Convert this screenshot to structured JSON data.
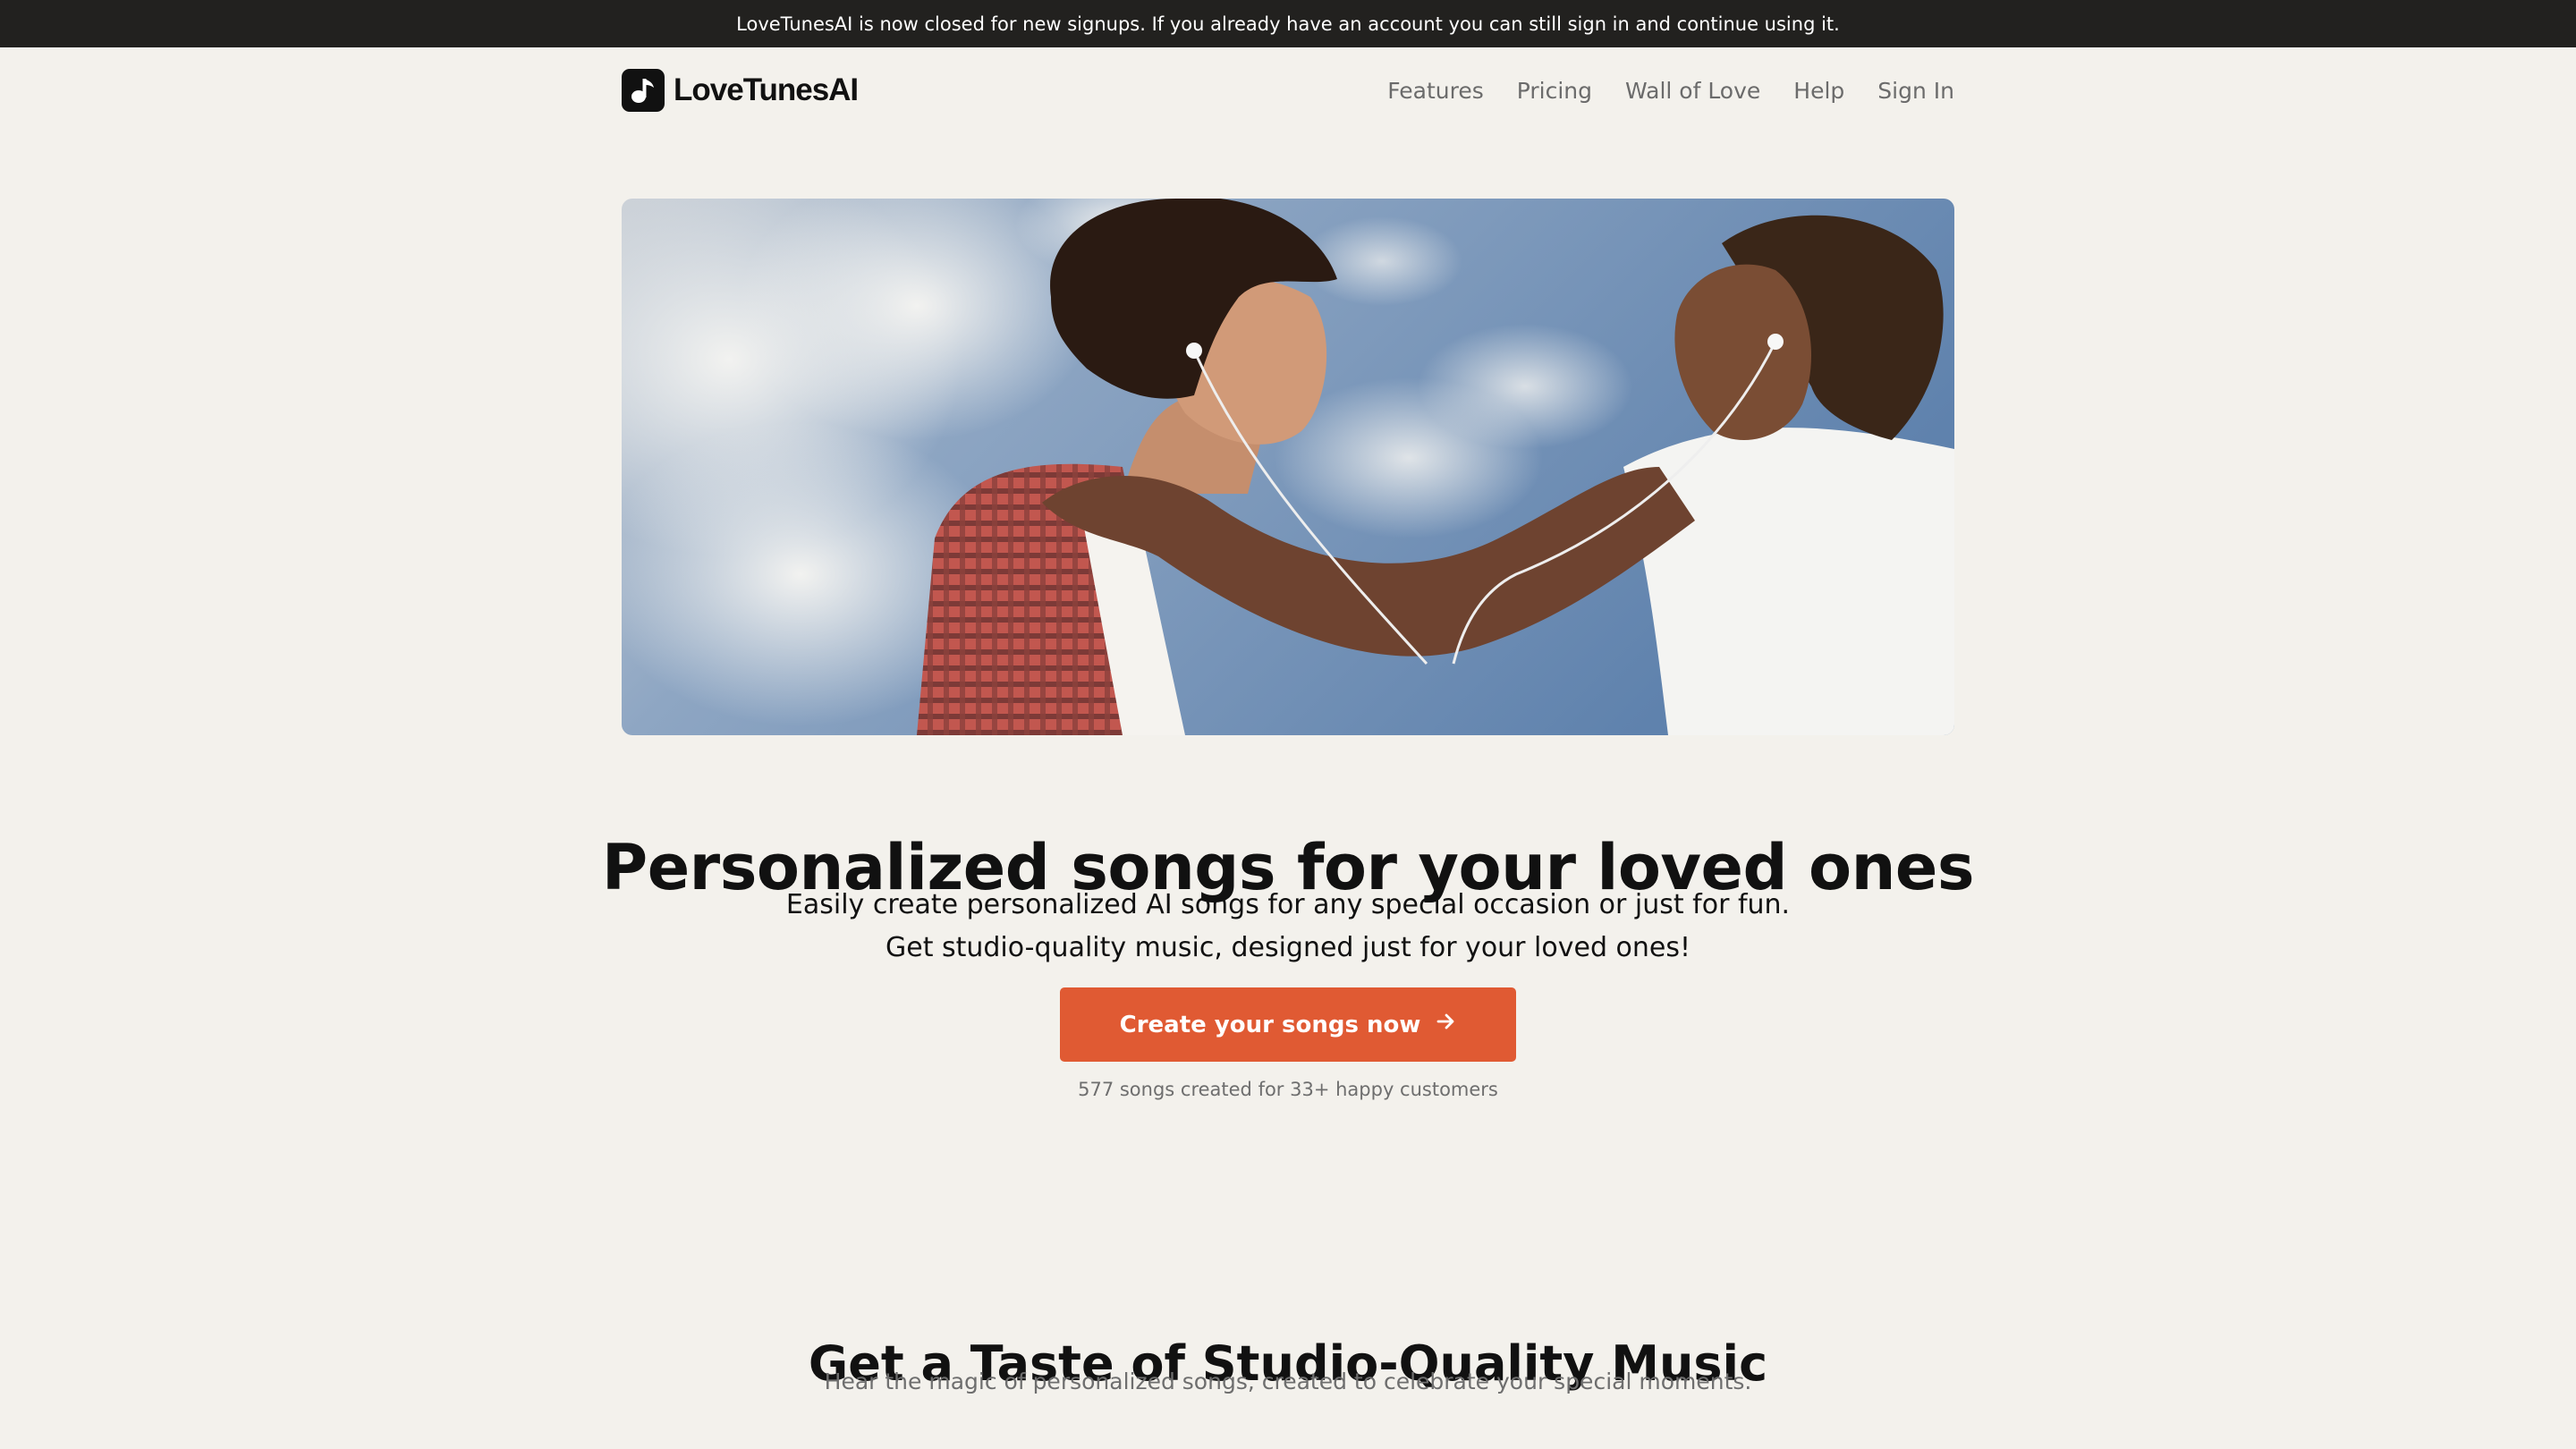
{
  "banner": {
    "text": "LoveTunesAI is now closed for new signups. If you already have an account you can still sign in and continue using it."
  },
  "nav": {
    "logo_text": "LoveTunesAI",
    "links": [
      {
        "label": "Features"
      },
      {
        "label": "Pricing"
      },
      {
        "label": "Wall of Love"
      },
      {
        "label": "Help"
      },
      {
        "label": "Sign In"
      }
    ]
  },
  "hero": {
    "image_icon": "hero-photo",
    "title": "Personalized songs for your loved ones",
    "subtitle_line1": "Easily create personalized AI songs for any special occasion or just for fun.",
    "subtitle_line2": "Get studio-quality music, designed just for your loved ones!",
    "cta_label": "Create your songs now",
    "cta_icon": "arrow-right-icon",
    "stats": "577 songs created for 33+ happy customers"
  },
  "section": {
    "title": "Get a Taste of Studio-Quality Music",
    "subtitle": "Hear the magic of personalized songs, created to celebrate your special moments."
  },
  "colors": {
    "background": "#f3f1ec",
    "banner": "#22211f",
    "accent": "#e05a33",
    "text": "#111111",
    "muted": "#6e6e6e"
  }
}
